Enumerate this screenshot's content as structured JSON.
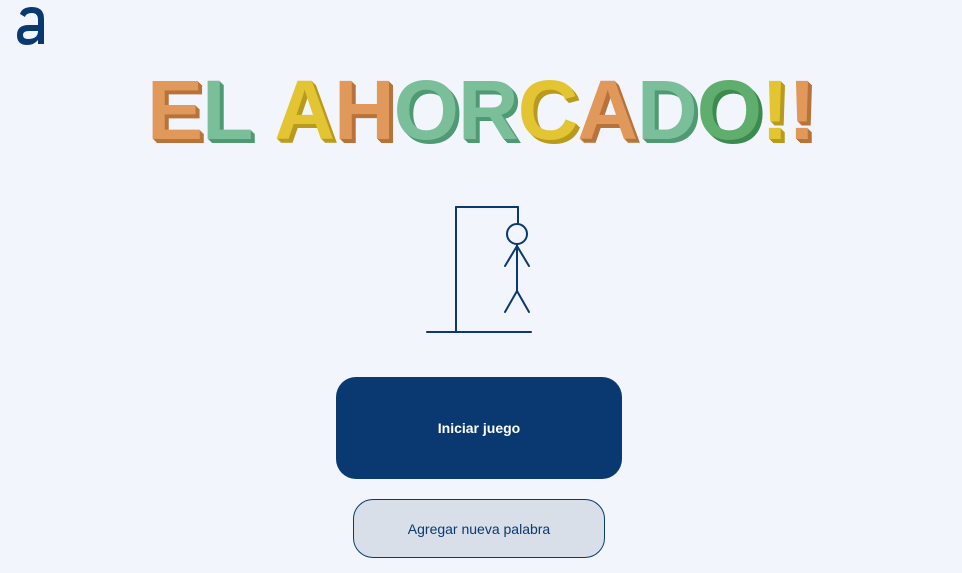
{
  "logo": {
    "icon": "alura-a-logo-icon",
    "letter": "a",
    "color": "#0a3871"
  },
  "title": {
    "text": "EL AHORCADO!!",
    "letters": [
      {
        "ch": "E",
        "color": "#e0995a",
        "shadow": "#b8733a"
      },
      {
        "ch": "L",
        "color": "#7bbf9a",
        "shadow": "#4f9a72"
      },
      {
        "ch": " ",
        "color": "",
        "shadow": ""
      },
      {
        "ch": "A",
        "color": "#e3c534",
        "shadow": "#b89a1c"
      },
      {
        "ch": "H",
        "color": "#e0995a",
        "shadow": "#b8733a"
      },
      {
        "ch": "O",
        "color": "#7bbf9a",
        "shadow": "#4f9a72"
      },
      {
        "ch": "R",
        "color": "#7bbf9a",
        "shadow": "#4f9a72"
      },
      {
        "ch": "C",
        "color": "#e3c534",
        "shadow": "#b89a1c"
      },
      {
        "ch": "A",
        "color": "#e0995a",
        "shadow": "#b8733a"
      },
      {
        "ch": "D",
        "color": "#7bbf9a",
        "shadow": "#4f9a72"
      },
      {
        "ch": "O",
        "color": "#5fae6e",
        "shadow": "#3d8a4e"
      },
      {
        "ch": "!",
        "color": "#e3c534",
        "shadow": "#b89a1c"
      },
      {
        "ch": "!",
        "color": "#e0995a",
        "shadow": "#b8733a"
      }
    ]
  },
  "illustration": {
    "icon": "hangman-icon",
    "color": "#0a3871"
  },
  "buttons": {
    "start_label": "Iniciar juego",
    "add_word_label": "Agregar nueva palabra"
  },
  "colors": {
    "background": "#f3f5fc",
    "primary": "#0a3871",
    "secondary_bg": "#d8dfe8"
  }
}
